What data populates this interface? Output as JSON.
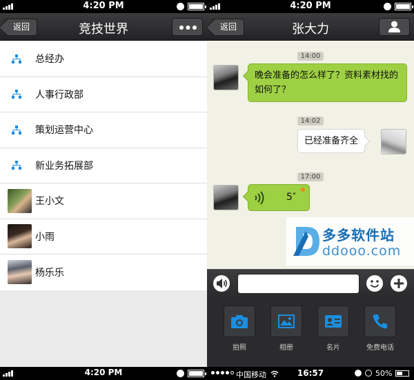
{
  "left": {
    "status": {
      "time": "4:20 PM"
    },
    "nav": {
      "back": "返回",
      "title": "竞技世界",
      "more": "•••"
    },
    "departments": [
      "总经办",
      "人事行政部",
      "策划运营中心",
      "新业务拓展部"
    ],
    "contacts": [
      "王小文",
      "小雨",
      "杨乐乐"
    ],
    "bottom_status": {
      "time": "4:20 PM"
    }
  },
  "right": {
    "status": {
      "time": "4:20 PM"
    },
    "nav": {
      "back": "返回",
      "title": "张大力"
    },
    "messages": {
      "ts1": "14:00",
      "msg1": "晚会准备的怎么样了？资料素材找的如何了？",
      "ts2": "14:02",
      "msg2": "已经准备齐全",
      "ts3": "17:00",
      "voice_duration": "5″"
    },
    "watermark": {
      "cn": "多多软件站",
      "en": "ddooo.com"
    },
    "tools": [
      "拍照",
      "相册",
      "名片",
      "免费电话"
    ],
    "bottom_status": {
      "carrier": "中国移动",
      "time": "16:57",
      "battery": "50%"
    }
  },
  "colors": {
    "accent_blue": "#1b8ee0",
    "bubble_green": "#9ed043",
    "nav_dark": "#2e2e30"
  }
}
